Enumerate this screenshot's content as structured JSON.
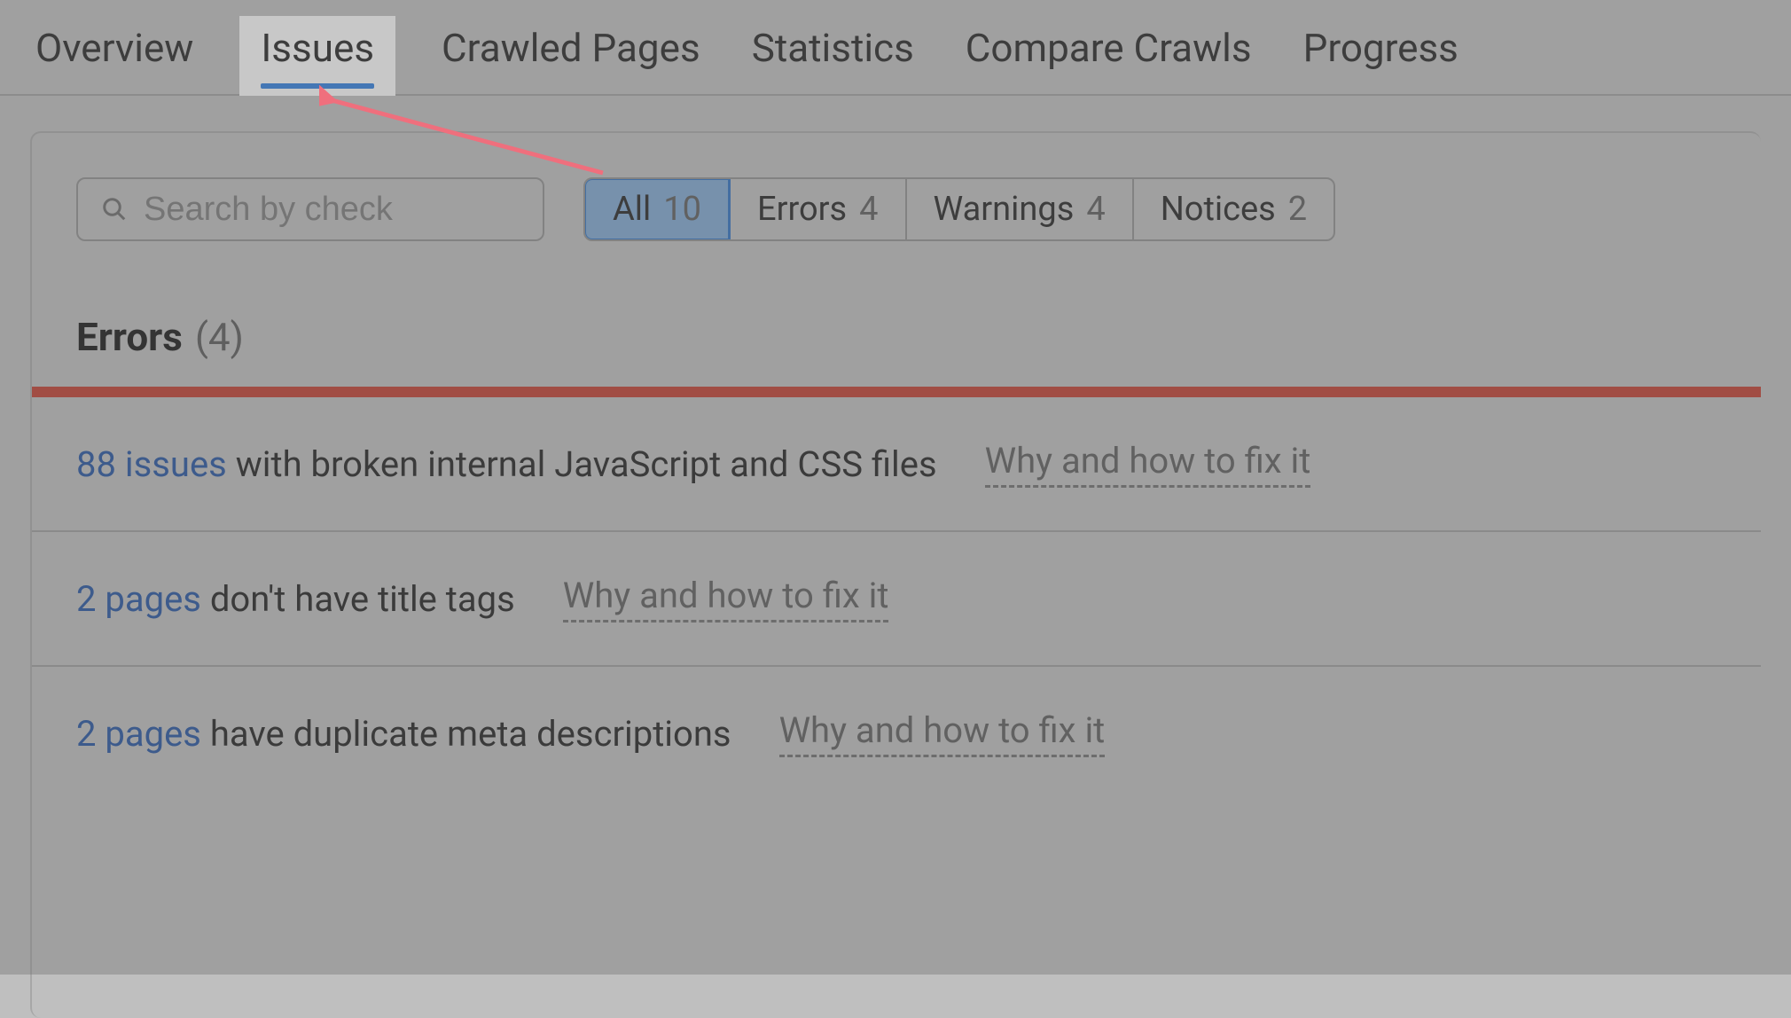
{
  "nav": {
    "tabs": [
      {
        "label": "Overview",
        "active": false
      },
      {
        "label": "Issues",
        "active": true
      },
      {
        "label": "Crawled Pages",
        "active": false
      },
      {
        "label": "Statistics",
        "active": false
      },
      {
        "label": "Compare Crawls",
        "active": false
      },
      {
        "label": "Progress",
        "active": false
      }
    ]
  },
  "search": {
    "placeholder": "Search by check"
  },
  "filters": {
    "all": {
      "label": "All",
      "count": "10",
      "active": true
    },
    "errors": {
      "label": "Errors",
      "count": "4",
      "active": false
    },
    "warnings": {
      "label": "Warnings",
      "count": "4",
      "active": false
    },
    "notices": {
      "label": "Notices",
      "count": "2",
      "active": false
    }
  },
  "section": {
    "title": "Errors",
    "count": "(4)"
  },
  "fix_label": "Why and how to fix it",
  "issues": [
    {
      "link_text": "88 issues",
      "rest_text": " with broken internal JavaScript and CSS files"
    },
    {
      "link_text": "2 pages",
      "rest_text": " don't have title tags"
    },
    {
      "link_text": "2 pages",
      "rest_text": " have duplicate meta descriptions"
    }
  ],
  "colors": {
    "accent_blue": "#2a7de1",
    "error_red": "#c0392b",
    "link_blue": "#1f4f9e"
  }
}
